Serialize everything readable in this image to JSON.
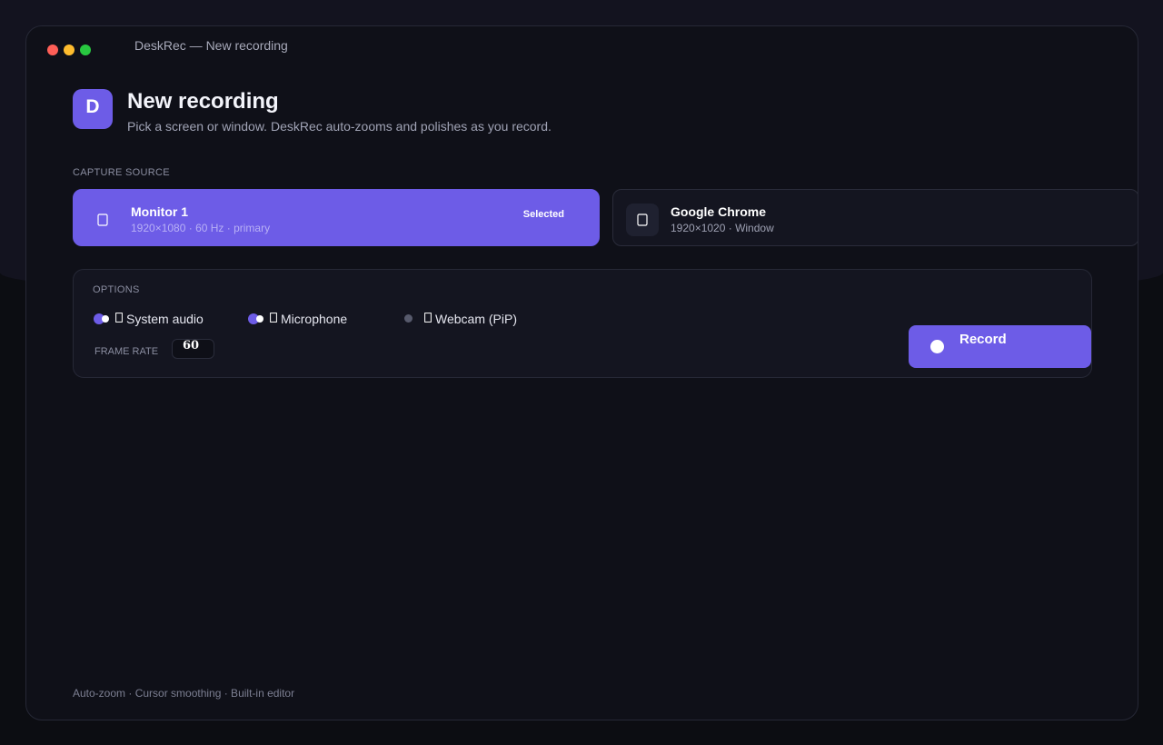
{
  "window": {
    "title": "DeskRec — New recording"
  },
  "app": {
    "logo_letter": "D"
  },
  "header": {
    "title": "New recording",
    "subtitle": "Pick a screen or window. DeskRec auto-zooms and polishes as you record."
  },
  "capture": {
    "label": "CAPTURE SOURCE",
    "sources": [
      {
        "name": "Monitor 1",
        "meta": "1920×1080 · 60 Hz · primary",
        "badge": "Selected",
        "selected": true,
        "icon": "monitor-icon"
      },
      {
        "name": "Google Chrome",
        "meta": "1920×1020 · Window",
        "selected": false,
        "icon": "window-icon"
      }
    ]
  },
  "options": {
    "label": "OPTIONS",
    "toggles": [
      {
        "label": "System audio",
        "on": true,
        "icon": "speaker-icon"
      },
      {
        "label": "Microphone",
        "on": true,
        "icon": "microphone-icon"
      },
      {
        "label": "Webcam (PiP)",
        "on": false,
        "icon": "webcam-icon"
      }
    ],
    "frame_rate": {
      "label": "FRAME RATE",
      "value": "60"
    }
  },
  "record": {
    "label": "Record"
  },
  "footer": {
    "text": "Auto-zoom · Cursor smoothing · Built-in editor"
  },
  "colors": {
    "accent": "#6d5ce7",
    "background": "#0f1018",
    "panel": "#141520"
  }
}
